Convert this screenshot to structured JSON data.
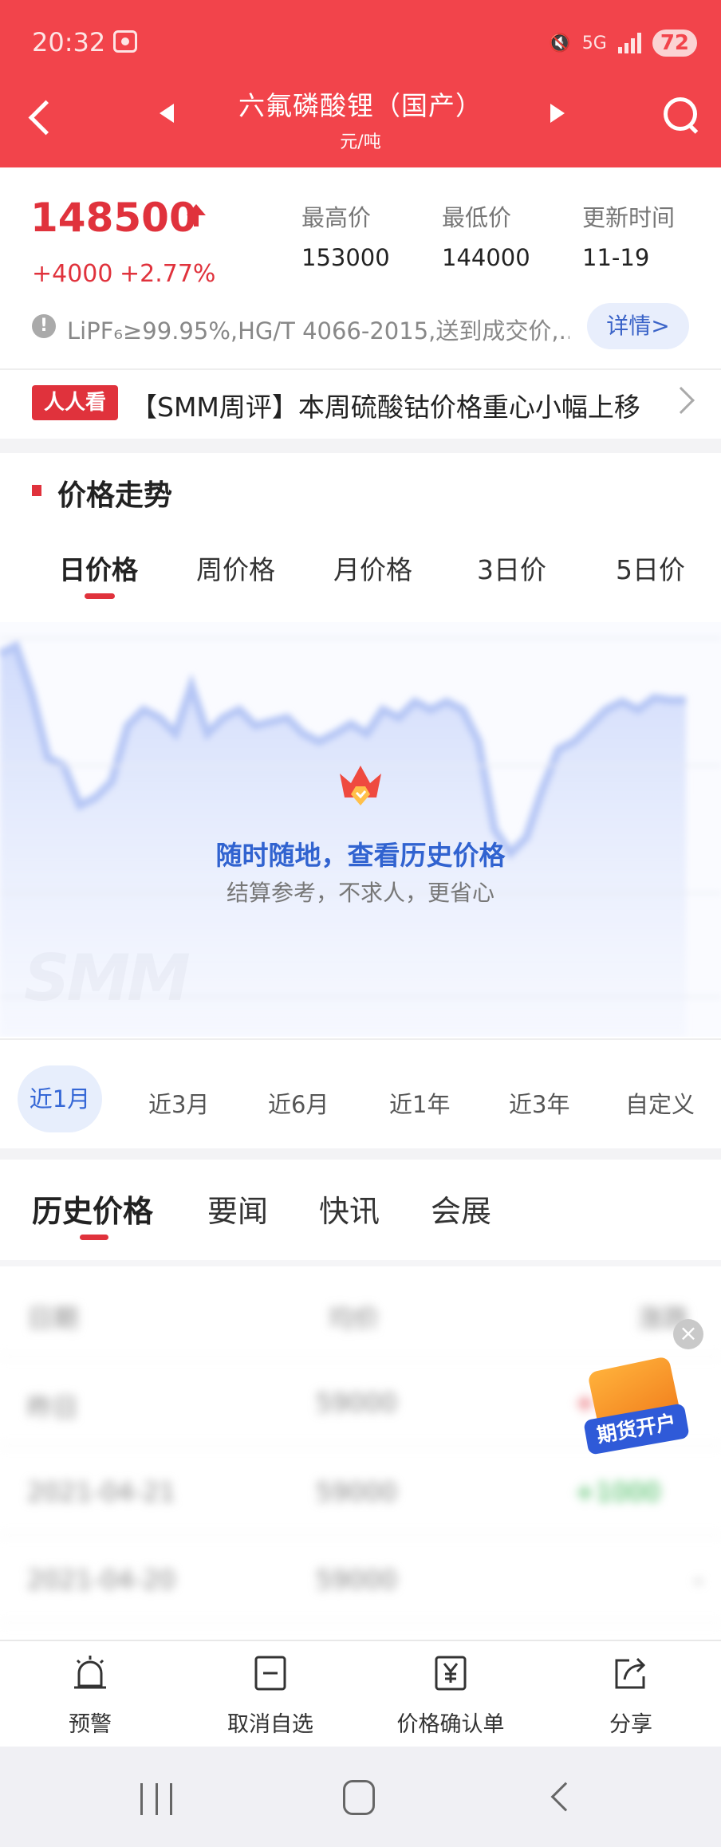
{
  "status_bar": {
    "time": "20:32",
    "network": "5G",
    "battery": "72"
  },
  "nav": {
    "title": "六氟磷酸锂（国产）",
    "subtitle": "元/吨"
  },
  "price": {
    "value": "148500",
    "change": "+4000",
    "change_pct": "+2.77%",
    "direction": "up",
    "color": "#e0323c"
  },
  "stats": [
    {
      "label": "最高价",
      "value": "153000"
    },
    {
      "label": "最低价",
      "value": "144000"
    },
    {
      "label": "更新时间",
      "value": "11-19"
    }
  ],
  "spec": {
    "text": "LiPF₆≥99.95%,HG/T 4066-2015,送到成交价,...",
    "detail_button": "详情>"
  },
  "news": {
    "badge": "人人看",
    "headline": "【SMM周评】本周硫酸钴价格重心小幅上移"
  },
  "trend": {
    "section_title": "价格走势",
    "period_tabs": [
      "日价格",
      "周价格",
      "月价格",
      "3日价",
      "5日价"
    ],
    "active_period": 0,
    "overlay_title": "随时随地，查看历史价格",
    "overlay_subtitle": "结算参考，不求人，更省心",
    "watermark": "SMM",
    "range_tabs": [
      "近1月",
      "近3月",
      "近6月",
      "近1年",
      "近3年",
      "自定义"
    ],
    "active_range": 0
  },
  "bottom_tabs": {
    "items": [
      "历史价格",
      "要闻",
      "快讯",
      "会展"
    ],
    "active": 0
  },
  "history_table": {
    "rows": [
      [
        "日期",
        "均价",
        "涨跌"
      ],
      [
        "昨日",
        "59000",
        "+1000"
      ],
      [
        "2021-04-21",
        "59000",
        "+1000"
      ],
      [
        "2021-04-20",
        "59000",
        "-"
      ]
    ]
  },
  "ad": {
    "close": "×",
    "label": "期货开户",
    "accent": "#2f5ad8"
  },
  "action_bar": [
    {
      "label": "预警",
      "icon": "alarm-icon"
    },
    {
      "label": "取消自选",
      "icon": "remove-watchlist-icon"
    },
    {
      "label": "价格确认单",
      "icon": "yuan-document-icon"
    },
    {
      "label": "分享",
      "icon": "share-icon"
    }
  ],
  "theme": {
    "header_bg": "#f2444b",
    "accent_red": "#e0323c",
    "accent_blue": "#3567d6"
  }
}
